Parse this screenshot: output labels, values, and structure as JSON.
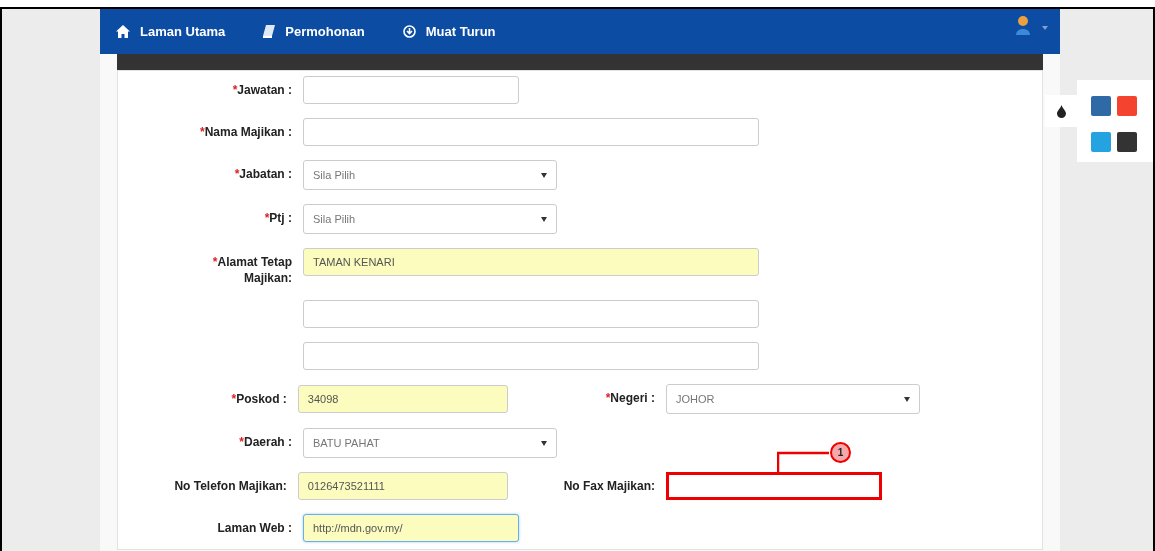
{
  "navbar": {
    "items": [
      {
        "label": "Laman Utama"
      },
      {
        "label": "Permohonan"
      },
      {
        "label": "Muat Turun"
      }
    ]
  },
  "form": {
    "rows": [
      {
        "fields": [
          {
            "kind": "text",
            "marker": "*",
            "label": "Jawatan :",
            "wide": false,
            "filled": false
          }
        ]
      },
      {
        "fields": [
          {
            "kind": "text",
            "marker": "*",
            "label": "Nama Majikan :",
            "wide": true,
            "filled": false
          }
        ]
      },
      {
        "fields": [
          {
            "kind": "select",
            "marker": "*",
            "label": "Jabatan :",
            "value": "Sila Pilih"
          }
        ]
      },
      {
        "fields": [
          {
            "kind": "select",
            "marker": "*",
            "label": "Ptj :",
            "value": "Sila Pilih"
          }
        ]
      },
      {
        "fields": [
          {
            "kind": "text",
            "marker": "*",
            "label": "Alamat Tetap\nMajikan:",
            "wide": true,
            "filled": true,
            "value": "TAMAN KENARI"
          }
        ]
      },
      {
        "fields": [
          {
            "kind": "text",
            "wide": true,
            "filled": false
          }
        ]
      },
      {
        "fields": [
          {
            "kind": "text",
            "wide": true,
            "filled": false
          }
        ]
      },
      {
        "fields": [
          {
            "kind": "text",
            "marker": "*",
            "label": "Poskod :",
            "wide": false,
            "filled": true,
            "value": "34098"
          },
          {
            "kind": "select",
            "marker": "*",
            "label": "Negeri :",
            "value": "JOHOR"
          }
        ]
      },
      {
        "fields": [
          {
            "kind": "select",
            "marker": "*",
            "label": "Daerah :",
            "value": "BATU PAHAT"
          }
        ]
      },
      {
        "fields": [
          {
            "kind": "text",
            "label": "No Telefon Majikan:",
            "wide": false,
            "filled": true,
            "value": "0126473521111"
          },
          {
            "kind": "text",
            "label": "No Fax Majikan:",
            "wide": false,
            "filled": false,
            "callout": "1"
          }
        ]
      },
      {
        "fields": [
          {
            "kind": "text",
            "label": "Laman Web :",
            "wide": false,
            "filled": true,
            "focused": true,
            "value": "http://mdn.gov.my/"
          }
        ]
      }
    ]
  },
  "theme_panel": {
    "swatches": [
      {
        "color": "#2f6aa7"
      },
      {
        "color": "#f4432f"
      },
      {
        "color": "#25a2e0"
      },
      {
        "color": "#333333"
      }
    ]
  }
}
